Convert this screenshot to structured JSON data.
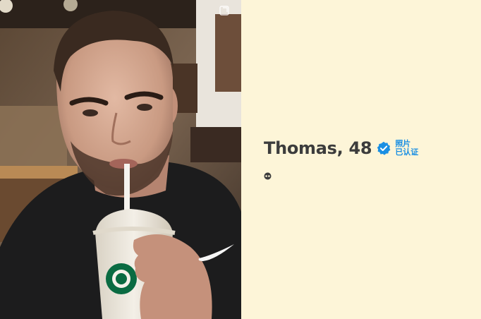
{
  "profile": {
    "name_age": "Thomas, 48",
    "verified_line1": "照片",
    "verified_line2": "已认证"
  },
  "colors": {
    "background": "#fdf5d8",
    "name": "#3c3c3c",
    "verified_blue": "#1a8fe3"
  },
  "icons": {
    "expand": "expand-icon",
    "verified": "verified-badge-icon",
    "status": "status-dots-icon"
  }
}
